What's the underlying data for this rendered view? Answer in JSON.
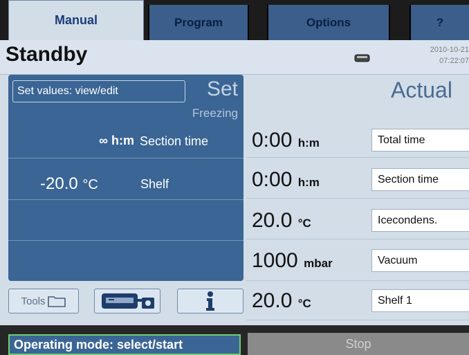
{
  "tabs": [
    {
      "label": "Manual",
      "active": true
    },
    {
      "label": "Program",
      "active": false
    },
    {
      "label": "Options",
      "active": false
    },
    {
      "label": "?",
      "active": false
    }
  ],
  "status": {
    "title": "Standby",
    "date": "2010-10-21",
    "time": "07:22:07"
  },
  "set_panel": {
    "edit_button": "Set values: view/edit",
    "heading": "Set",
    "phase": "Freezing",
    "section_time_value": "∞ h:m",
    "section_time_label": "Section time",
    "shelf_value": "-20.0",
    "shelf_unit": "°C",
    "shelf_label": "Shelf"
  },
  "toolbar": {
    "tools_label": "Tools"
  },
  "actual": {
    "heading": "Actual",
    "rows": [
      {
        "value": "0:00",
        "unit": "h:m",
        "label": "Total time"
      },
      {
        "value": "0:00",
        "unit": "h:m",
        "label": "Section time"
      },
      {
        "value": "20.0",
        "unit": "°C",
        "label": "Icecondens."
      },
      {
        "value": "1000",
        "unit": "mbar",
        "label": "Vacuum"
      },
      {
        "value": "20.0",
        "unit": "°C",
        "label": "Shelf 1"
      }
    ]
  },
  "bottom": {
    "operating_mode": "Operating mode: select/start",
    "stop": "Stop"
  },
  "colors": {
    "panel_blue": "#3a6594",
    "tab_blue": "#3b5f8a",
    "background": "#d2dde8",
    "active_outline": "#6fcf6f"
  }
}
